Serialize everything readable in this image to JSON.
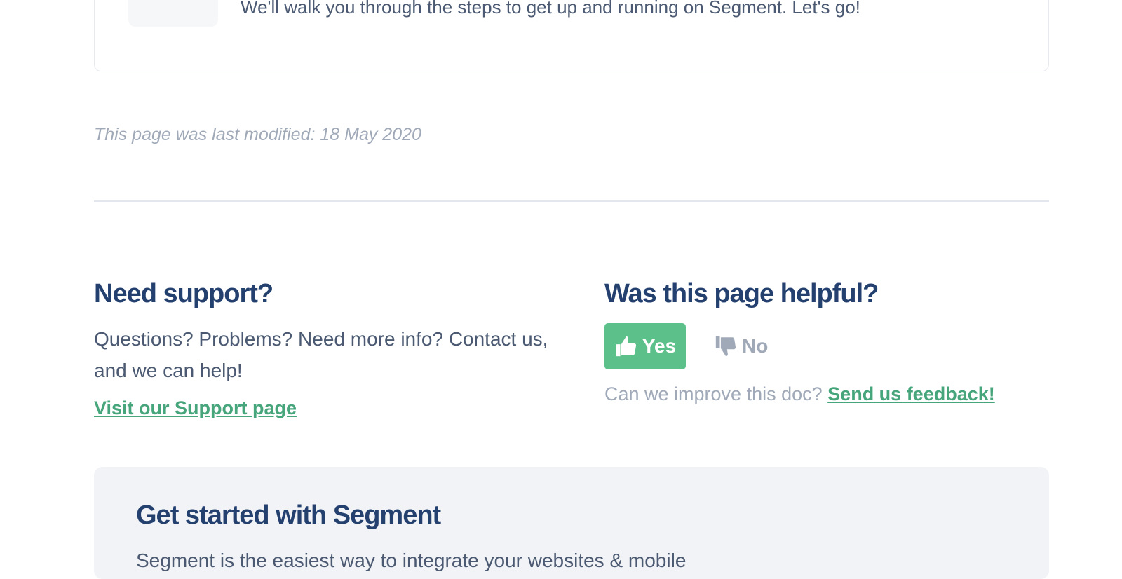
{
  "intro_card": {
    "text": "We'll walk you through the steps to get up and running on Segment. Let's go!"
  },
  "last_modified": "This page was last modified: 18 May 2020",
  "support": {
    "title": "Need support?",
    "text": "Questions? Problems? Need more info? Contact us, and we can help!",
    "link_label": "Visit our Support page"
  },
  "helpful": {
    "title": "Was this page helpful?",
    "yes_label": "Yes",
    "no_label": "No",
    "improve_text": "Can we improve this doc?",
    "feedback_link": "Send us feedback!"
  },
  "cta": {
    "title": "Get started with Segment",
    "text": "Segment is the easiest way to integrate your websites & mobile"
  },
  "colors": {
    "heading": "#24406f",
    "accent_green": "#5cc08b",
    "link_green": "#47a57c",
    "muted": "#a0a9b8"
  },
  "icons": [
    "thumbs-up-icon",
    "thumbs-down-icon"
  ]
}
